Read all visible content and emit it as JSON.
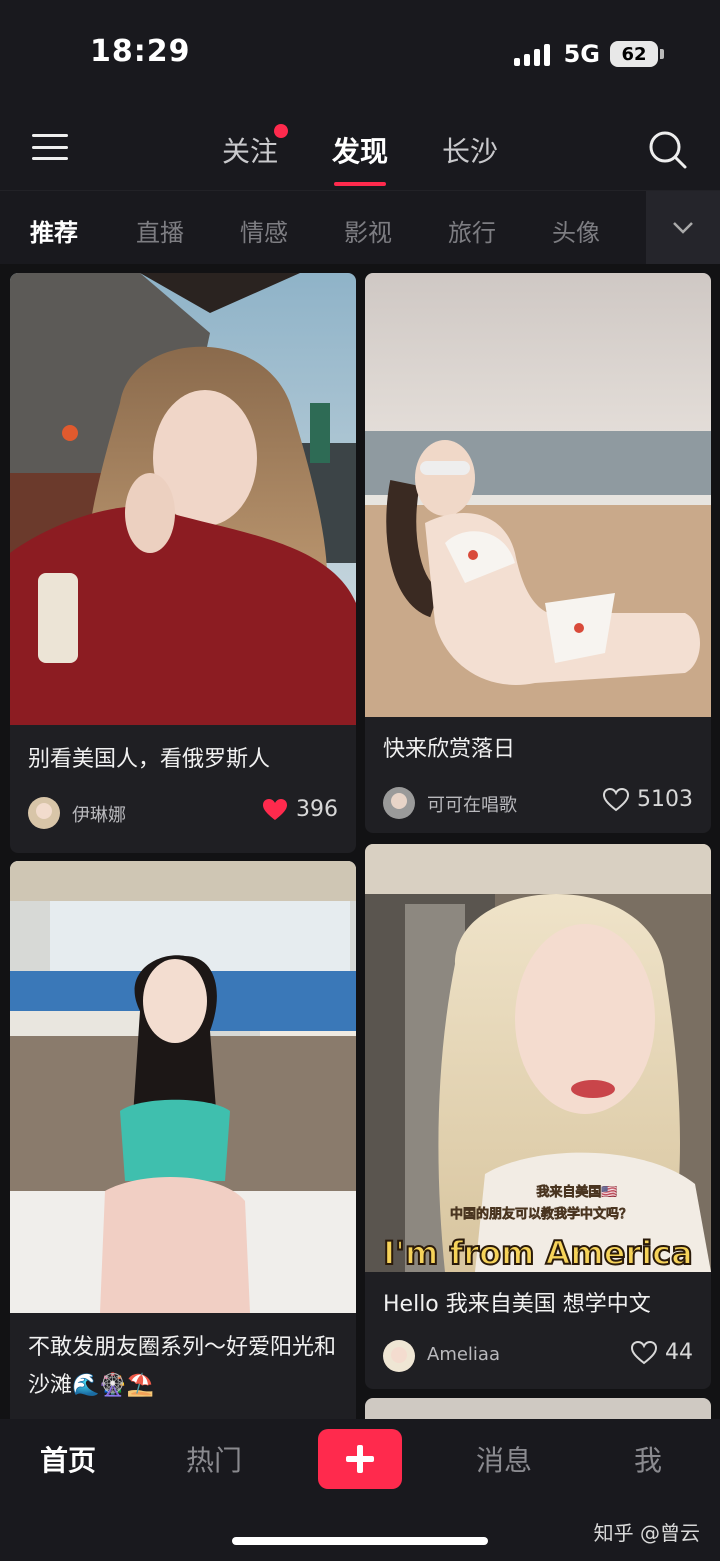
{
  "status_bar": {
    "time": "18:29",
    "network": "5G",
    "battery": "62"
  },
  "top_nav": {
    "tabs": [
      {
        "label": "关注",
        "has_badge": true
      },
      {
        "label": "发现",
        "active": true
      },
      {
        "label": "长沙"
      }
    ]
  },
  "categories": {
    "items": [
      "推荐",
      "直播",
      "情感",
      "影视",
      "旅行",
      "头像"
    ],
    "active": "推荐"
  },
  "feed": {
    "cards": [
      {
        "title": "别看美国人，看俄罗斯人",
        "author": "伊琳娜",
        "likes": "396",
        "liked": true
      },
      {
        "title": "快来欣赏落日",
        "author": "可可在唱歌",
        "likes": "5103",
        "liked": false
      },
      {
        "title": "不敢发朋友圈系列～好爱阳光和沙滩🌊🎡⛱️",
        "author": "",
        "likes": "",
        "liked": false
      },
      {
        "title": "Hello 我来自美国 想学中文",
        "author": "Ameliaa",
        "likes": "44",
        "liked": false,
        "overlay": {
          "line1": "我来自美国🇺🇸",
          "line2": "中国的朋友可以教我学中文吗？",
          "headline": "I'm from America"
        }
      }
    ]
  },
  "tab_bar": {
    "tabs": [
      {
        "label": "首页",
        "active": true
      },
      {
        "label": "热门"
      },
      {
        "label": "消息"
      },
      {
        "label": "我"
      }
    ],
    "add_icon": "plus-icon"
  },
  "watermark": "知乎 @曾云",
  "colors": {
    "accent": "#ff2a4d",
    "background": "#19191e",
    "card": "#1f1f23"
  }
}
